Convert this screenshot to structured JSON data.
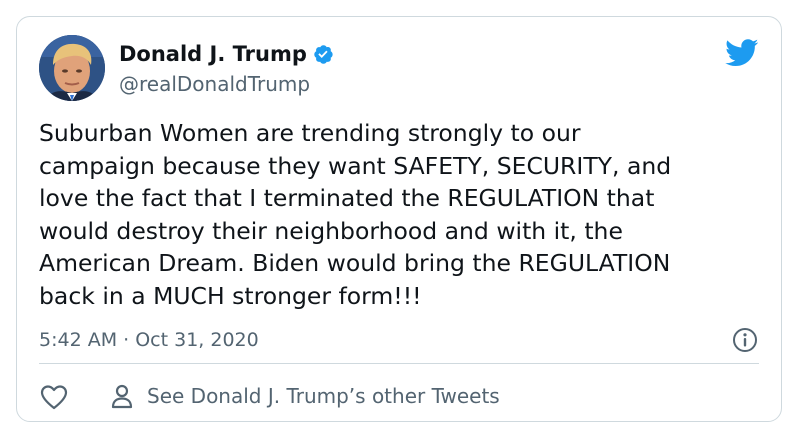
{
  "author": {
    "name": "Donald J. Trump",
    "handle": "@realDonaldTrump",
    "verified": true
  },
  "icons": {
    "avatar": "profile-photo",
    "verified": "verified-badge-icon",
    "brand": "twitter-bird-icon",
    "info": "info-icon",
    "like": "heart-icon",
    "profile": "person-icon"
  },
  "tweet": {
    "text": "Suburban Women are trending strongly to our\ncampaign because they want SAFETY, SECURITY, and\nlove the fact that I terminated the REGULATION that\nwould destroy their neighborhood and with it, the\nAmerican Dream. Biden would bring the REGULATION\nback in a MUCH stronger form!!!",
    "timestamp": "5:42 AM · Oct 31, 2020"
  },
  "actions": {
    "see_other_label": "See Donald J. Trump’s other Tweets"
  },
  "colors": {
    "text": "#0f1419",
    "secondary": "#536471",
    "twitter_blue": "#1d9bf0",
    "border": "#cfd9de"
  }
}
